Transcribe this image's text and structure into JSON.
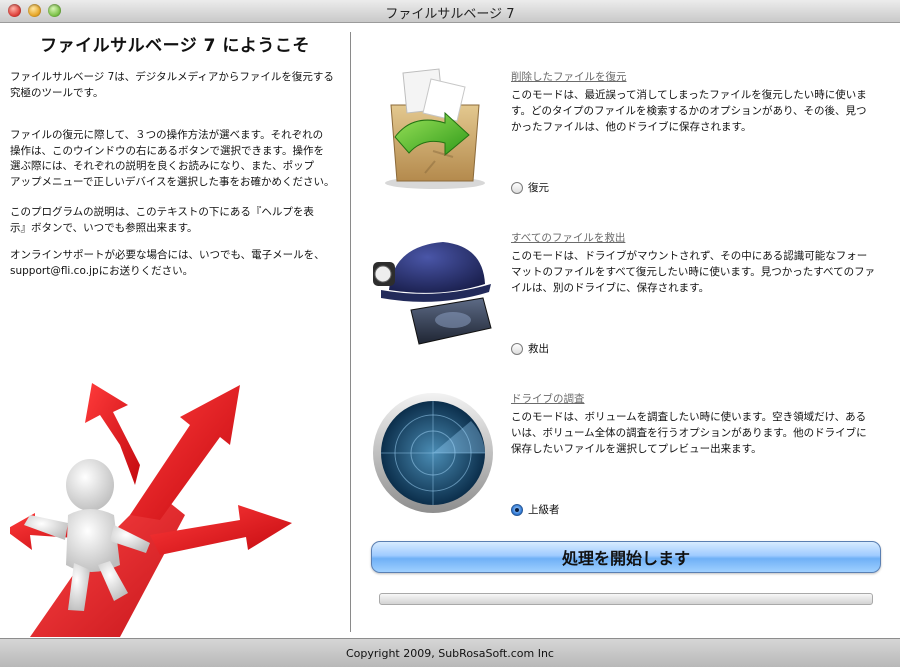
{
  "window": {
    "title": "ファイルサルベージ 7"
  },
  "welcome": {
    "title": "ファイルサルベージ 7 にようこそ",
    "p1": "ファイルサルベージ 7は、デジタルメディアからファイルを復元する\n究極のツールです。",
    "p2": "ファイルの復元に際して、３つの操作方法が選べます。それぞれの\n操作は、このウインドウの右にあるボタンで選択できます。操作を\n選ぶ際には、それぞれの説明を良くお読みになり、また、ポップ\nアップメニューで正しいデバイスを選択した事をお確かめください。",
    "p3": "このプログラムの説明は、このテキストの下にある『ヘルプを表\n示』ボタンで、いつでも参照出来ます。",
    "p4": "オンラインサポートが必要な場合には、いつでも、電子メールを、\nsupport@fli.co.jpにお送りください。"
  },
  "modes": [
    {
      "heading": "削除したファイルを復元",
      "desc": "このモードは、最近誤って消してしまったファイルを復元したい時に使います。どのタイプのファイルを検索するかのオプションがあり、その後、見つかったファイルは、他のドライブに保存されます。",
      "radio_label": "復元",
      "selected": false,
      "icon": "recycle-box-icon"
    },
    {
      "heading": "すべてのファイルを救出",
      "desc": "このモードは、ドライブがマウントされず、その中にある認識可能なフォーマットのファイルをすべて復元したい時に使います。見つかったすべてのファイルは、別のドライブに、保存されます。",
      "radio_label": "救出",
      "selected": false,
      "icon": "rescue-helmet-icon"
    },
    {
      "heading": "ドライブの調査",
      "desc": "このモードは、ボリュームを調査したい時に使います。空き領域だけ、あるいは、ボリューム全体の調査を行うオプションがあります。他のドライブに保存したいファイルを選択してプレビュー出来ます。",
      "radio_label": "上級者",
      "selected": true,
      "icon": "radar-icon"
    }
  ],
  "start_button": "処理を開始します",
  "progress": 0,
  "footer": {
    "copyright": "Copyright 2009, SubRosaSoft.com Inc"
  },
  "colors": {
    "accent": "#6fb0f6",
    "arrow_red": "#e3131b"
  }
}
